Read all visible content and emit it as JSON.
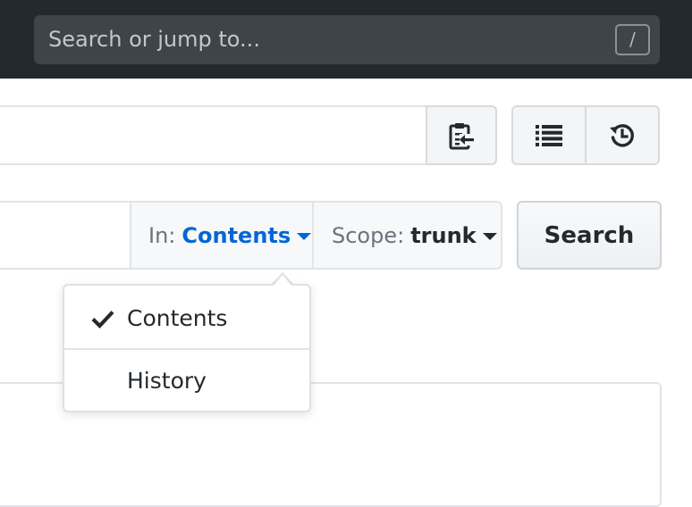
{
  "header": {
    "search": {
      "placeholder": "Search or jump to...",
      "shortcut_key": "/"
    }
  },
  "toolbar": {
    "copy_icon": "clipboard-copy-icon",
    "list_icon": "list-unordered-icon",
    "history_icon": "history-icon"
  },
  "code_search": {
    "in_label": "In:",
    "in_value": "Contents",
    "scope_label": "Scope:",
    "scope_value": "trunk",
    "search_button": "Search"
  },
  "in_dropdown": {
    "items": [
      {
        "label": "Contents",
        "selected": true
      },
      {
        "label": "History",
        "selected": false
      }
    ]
  },
  "colors": {
    "header_bg": "#24292e",
    "accent_blue": "#0366d6"
  }
}
